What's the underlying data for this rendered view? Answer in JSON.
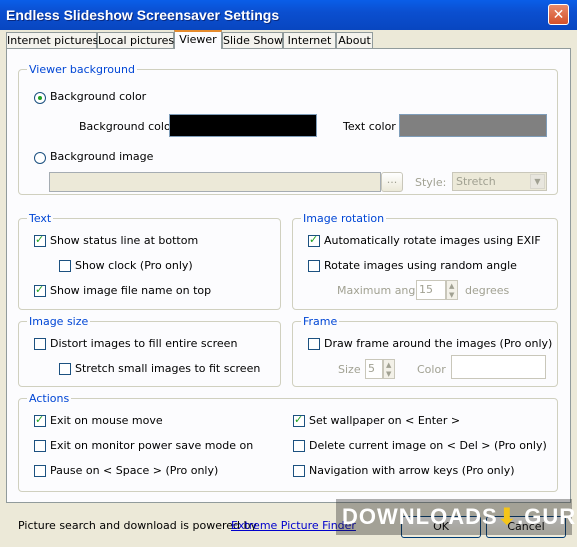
{
  "window": {
    "title": "Endless Slideshow Screensaver Settings",
    "close_glyph": "✕"
  },
  "tabs": [
    {
      "label": "Internet pictures",
      "active": false
    },
    {
      "label": "Local pictures",
      "active": false
    },
    {
      "label": "Viewer",
      "active": true
    },
    {
      "label": "Slide Show",
      "active": false
    },
    {
      "label": "Internet",
      "active": false
    },
    {
      "label": "About",
      "active": false
    }
  ],
  "viewer_background": {
    "legend": "Viewer background",
    "background_color_radio": {
      "label": "Background color",
      "checked": true
    },
    "background_color_label": "Background color",
    "background_color_value": "#000000",
    "text_color_label": "Text color",
    "text_color_value": "#808080",
    "background_image_radio": {
      "label": "Background image",
      "checked": false
    },
    "image_path": "",
    "browse_label": "...",
    "style_label": "Style:",
    "style_value": "Stretch"
  },
  "text_group": {
    "legend": "Text",
    "show_status": {
      "label": "Show status line at bottom",
      "checked": true
    },
    "show_clock": {
      "label": "Show clock (Pro only)",
      "checked": false
    },
    "show_filename": {
      "label": "Show image file name on top",
      "checked": true
    }
  },
  "image_rotation": {
    "legend": "Image rotation",
    "auto_rotate": {
      "label": "Automatically rotate images using EXIF",
      "checked": true
    },
    "random_rotate": {
      "label": "Rotate images using random angle",
      "checked": false
    },
    "max_angle_label": "Maximum angle",
    "max_angle_value": "15",
    "degrees_label": "degrees"
  },
  "image_size": {
    "legend": "Image size",
    "distort": {
      "label": "Distort images to fill entire screen",
      "checked": false
    },
    "stretch_small": {
      "label": "Stretch small images to fit screen",
      "checked": false
    }
  },
  "frame": {
    "legend": "Frame",
    "draw_frame": {
      "label": "Draw frame around the images (Pro only)",
      "checked": false
    },
    "size_label": "Size",
    "size_value": "5",
    "color_label": "Color",
    "color_value": "#ffffff"
  },
  "actions": {
    "legend": "Actions",
    "exit_mouse": {
      "label": "Exit on mouse move",
      "checked": true
    },
    "exit_power": {
      "label": "Exit on monitor power save mode on",
      "checked": false
    },
    "pause_space": {
      "label": "Pause on < Space > (Pro only)",
      "checked": false
    },
    "set_wallpaper": {
      "label": "Set wallpaper on < Enter >",
      "checked": true
    },
    "delete_current": {
      "label": "Delete current image on < Del > (Pro only)",
      "checked": false
    },
    "navigation": {
      "label": "Navigation with arrow keys (Pro only)",
      "checked": false
    }
  },
  "footer": {
    "powered_text": "Picture search and download is powered by",
    "powered_link": "Extreme Picture Finder",
    "ok_label": "OK",
    "cancel_label": "Cancel"
  },
  "watermark": {
    "text": "DOWNLOADS",
    "arrow": "⬇",
    "suffix": ".GURU"
  }
}
